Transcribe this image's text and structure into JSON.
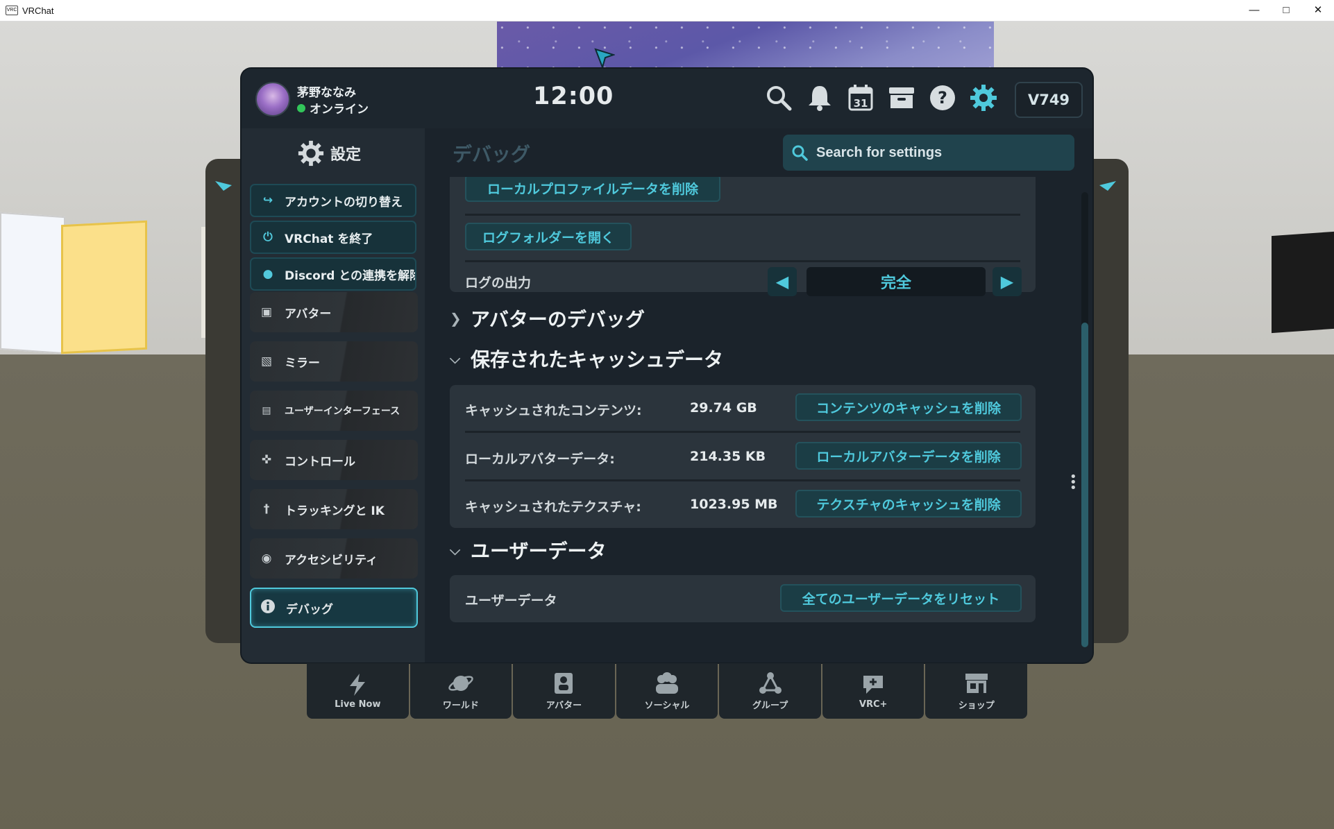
{
  "window": {
    "title": "VRChat",
    "app_icon_text": "VRC"
  },
  "topbar": {
    "username": "茅野ななみ",
    "status": "オンライン",
    "status_color": "#32c65a",
    "clock": "12:00",
    "icons": [
      "search-icon",
      "bell-icon",
      "calendar-icon",
      "inbox-icon",
      "help-icon",
      "gear-icon"
    ],
    "calendar_day": "31",
    "credits": "V749"
  },
  "sidebar": {
    "title": "設定",
    "actions": [
      {
        "label": "アカウントの切り替え",
        "icon": "switch-account-icon"
      },
      {
        "label": "VRChat を終了",
        "icon": "power-icon"
      },
      {
        "label": "Discord との連携を解除",
        "icon": "discord-icon"
      }
    ],
    "items": [
      {
        "label": "アバター",
        "icon": "avatar-icon"
      },
      {
        "label": "ミラー",
        "icon": "mirror-icon"
      },
      {
        "label": "ユーザーインターフェース",
        "icon": "interface-icon"
      },
      {
        "label": "コントロール",
        "icon": "gamepad-icon"
      },
      {
        "label": "トラッキングと IK",
        "icon": "tracking-icon"
      },
      {
        "label": "アクセシビリティ",
        "icon": "accessibility-icon"
      },
      {
        "label": "デバッグ",
        "icon": "info-icon",
        "active": true
      }
    ]
  },
  "content": {
    "section_title": "デバッグ",
    "search_placeholder": "Search for settings",
    "partial_button": "ローカルプロファイルデータを削除",
    "open_log_folder": "ログフォルダーを開く",
    "log_output": {
      "label": "ログの出力",
      "value": "完全"
    },
    "categories": {
      "avatar_debug": "アバターのデバッグ",
      "saved_cache": "保存されたキャッシュデータ",
      "user_data": "ユーザーデータ"
    },
    "cache_rows": [
      {
        "label": "キャッシュされたコンテンツ:",
        "value": "29.74 GB",
        "button": "コンテンツのキャッシュを削除"
      },
      {
        "label": "ローカルアバターデータ:",
        "value": "214.35 KB",
        "button": "ローカルアバターデータを削除"
      },
      {
        "label": "キャッシュされたテクスチャ:",
        "value": "1023.95 MB",
        "button": "テクスチャのキャッシュを削除"
      }
    ],
    "user_data_row": {
      "label": "ユーザーデータ",
      "button": "全てのユーザーデータをリセット"
    }
  },
  "dock": [
    {
      "label": "Live Now",
      "icon": "lightning-icon"
    },
    {
      "label": "ワールド",
      "icon": "planet-icon"
    },
    {
      "label": "アバター",
      "icon": "avatar-icon"
    },
    {
      "label": "ソーシャル",
      "icon": "people-icon"
    },
    {
      "label": "グループ",
      "icon": "group-icon"
    },
    {
      "label": "VRC+",
      "icon": "vrc-plus-icon"
    },
    {
      "label": "ショップ",
      "icon": "shop-icon"
    }
  ],
  "accent_color": "#4fc9dc"
}
